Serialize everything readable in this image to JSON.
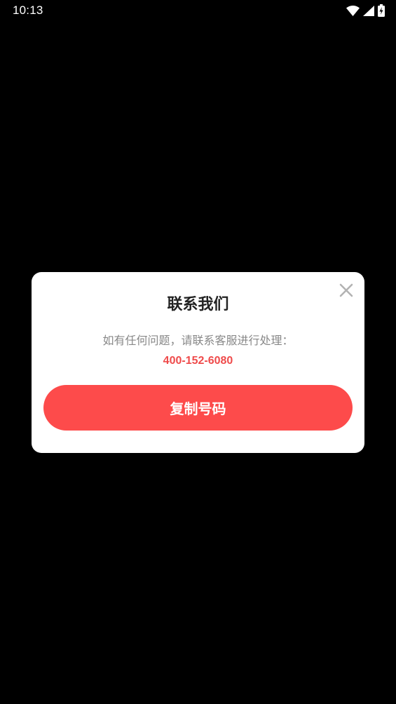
{
  "status_bar": {
    "time": "10:13",
    "icons": [
      "wifi-icon",
      "cellular-signal-icon",
      "battery-charging-icon"
    ],
    "text_color": "#ffffff"
  },
  "background_color": "#000000",
  "dialog": {
    "title": "联系我们",
    "message": "如有任何问题，请联系客服进行处理：",
    "phone": "400-152-6080",
    "copy_button_label": "复制号码",
    "close_icon": "close-icon",
    "accent_color": "#fd4b4b",
    "phone_color": "#ef4b4b",
    "background_color": "#ffffff"
  }
}
